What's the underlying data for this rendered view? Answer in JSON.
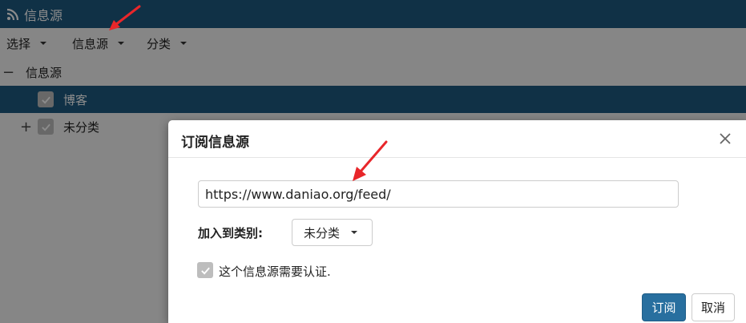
{
  "header": {
    "title": "信息源",
    "icon": "rss-icon"
  },
  "menubar": {
    "items": [
      {
        "label": "选择"
      },
      {
        "label": "信息源"
      },
      {
        "label": "分类"
      }
    ]
  },
  "tree": {
    "root": {
      "toggle": "−",
      "label": "信息源"
    },
    "children": [
      {
        "label": "博客",
        "checked": true,
        "selected": true
      },
      {
        "toggle": "+",
        "label": "未分类",
        "checked": true,
        "selected": false
      }
    ]
  },
  "modal": {
    "title": "订阅信息源",
    "url_value": "https://www.daniao.org/feed/",
    "category_label": "加入到类别:",
    "category_selected": "未分类",
    "auth_checked": true,
    "auth_label": "这个信息源需要认证.",
    "subscribe_label": "订阅",
    "cancel_label": "取消"
  },
  "colors": {
    "accent": "#1e5a80",
    "primary_button": "#286f9f",
    "arrow": "#e8262a"
  }
}
